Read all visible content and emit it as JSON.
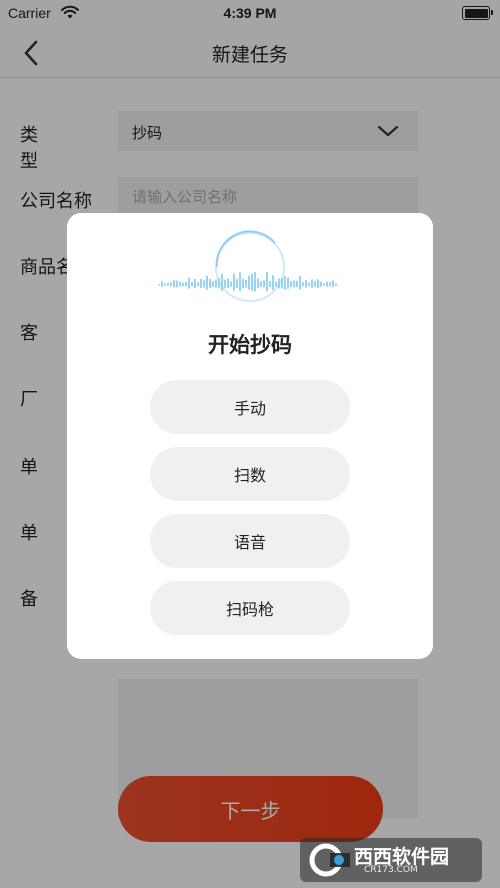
{
  "status_bar": {
    "carrier": "Carrier",
    "time": "4:39 PM",
    "wifi_icon": "wifi-icon",
    "battery_icon": "battery-icon"
  },
  "nav": {
    "back_icon": "chevron-left-icon",
    "title": "新建任务"
  },
  "form": {
    "type": {
      "label": "类型",
      "value": "抄码"
    },
    "company": {
      "label": "公司名称",
      "placeholder": "请输入公司名称"
    },
    "rows": [
      {
        "label": "商品名"
      },
      {
        "label": "客"
      },
      {
        "label": "厂"
      },
      {
        "label": "单"
      },
      {
        "label": "单"
      },
      {
        "label": "备"
      }
    ],
    "next_label": "下一步"
  },
  "dialog": {
    "title": "开始抄码",
    "options": [
      "手动",
      "扫数",
      "语音",
      "扫码枪"
    ]
  },
  "watermark": {
    "text": "西西软件园",
    "sub": "CR173.COM"
  },
  "colors": {
    "accent": "#E9472A",
    "waveform": "#7EC8F0"
  }
}
